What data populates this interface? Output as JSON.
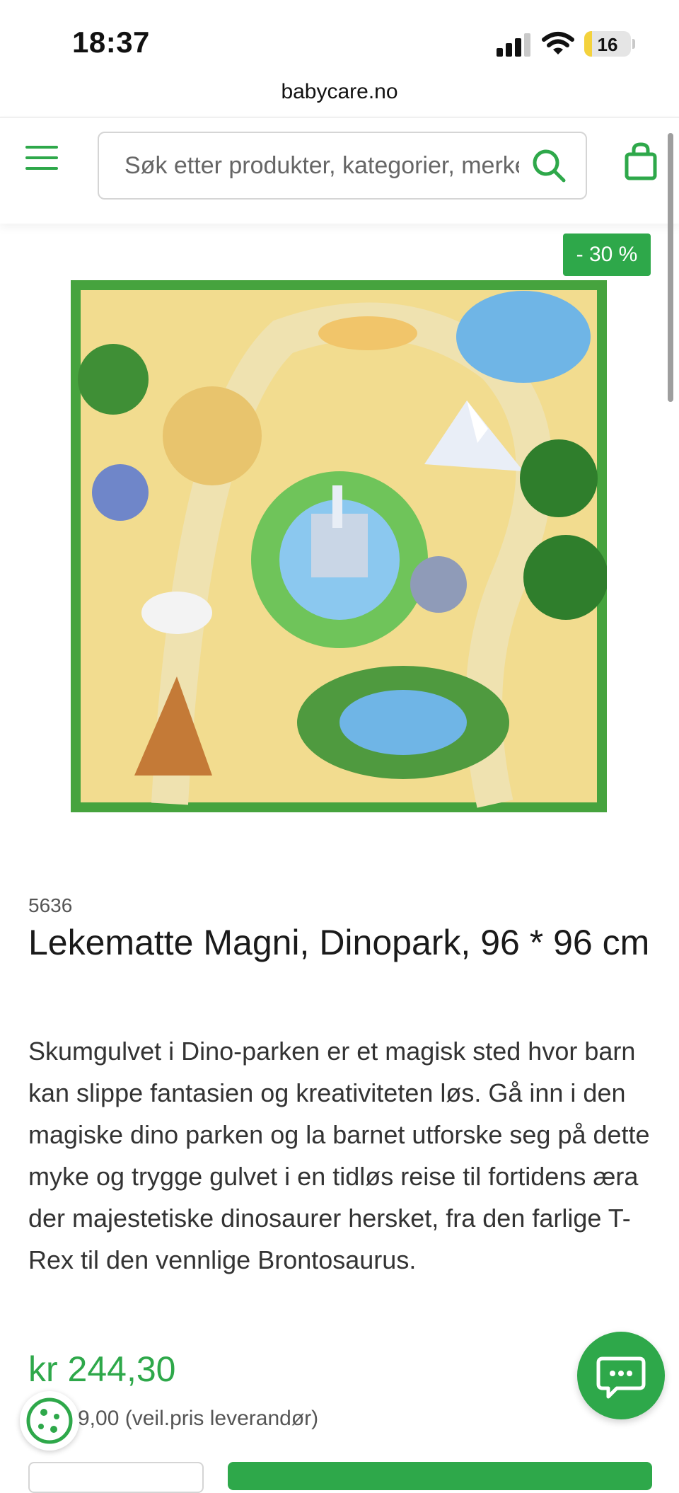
{
  "status_bar": {
    "time": "18:37",
    "battery": "16"
  },
  "browser": {
    "url": "babycare.no"
  },
  "header": {
    "search_placeholder": "Søk etter produkter, kategorier, merker..."
  },
  "product": {
    "discount_badge": "- 30 %",
    "sku": "5636",
    "title": "Lekematte Magni, Dinopark, 96 * 96 cm",
    "description": "Skumgulvet i Dino-parken er et magisk sted hvor barn kan slippe fantasien og kreativiteten løs. Gå inn i den magiske dino parken og la barnet utforske seg på dette myke og trygge gulvet i en tidløs reise til fortidens æra der majestetiske dinosaurer hersket, fra den farlige T-Rex til den vennlige Brontosaurus.",
    "price": "kr 244,30",
    "old_price": "9,00 (veil.pris leverandør)"
  },
  "colors": {
    "accent": "#2ea84a"
  },
  "icons": [
    "menu-icon",
    "search-icon",
    "cart-icon",
    "chat-icon",
    "cookie-icon",
    "signal-icon",
    "wifi-icon",
    "battery-icon"
  ]
}
